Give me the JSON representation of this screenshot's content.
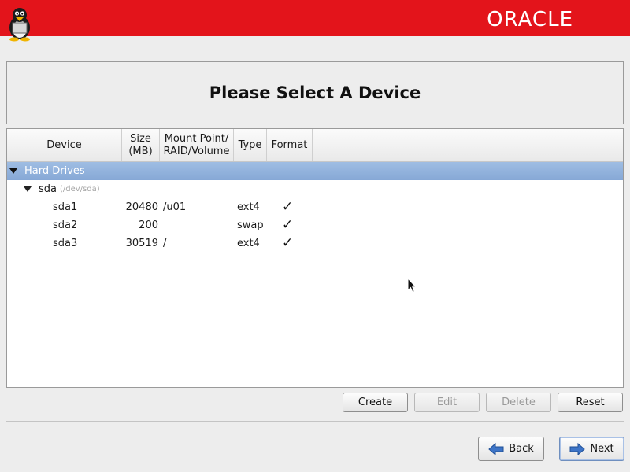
{
  "header": {
    "brand": "ORACLE",
    "brand_color": "#e3141b",
    "mascot_icon": "tux-penguin-icon"
  },
  "page": {
    "title": "Please Select A Device"
  },
  "table": {
    "columns": [
      "Device",
      "Size\n(MB)",
      "Mount Point/\nRAID/Volume",
      "Type",
      "Format"
    ],
    "group": {
      "label": "Hard Drives",
      "expanded": true
    },
    "disk": {
      "name": "sda",
      "path": "(/dev/sda)",
      "expanded": true
    },
    "partitions": [
      {
        "device": "sda1",
        "size": "20480",
        "mount": "/u01",
        "type": "ext4",
        "format": "✓"
      },
      {
        "device": "sda2",
        "size": "200",
        "mount": "",
        "type": "swap",
        "format": "✓"
      },
      {
        "device": "sda3",
        "size": "30519",
        "mount": "/",
        "type": "ext4",
        "format": "✓"
      }
    ]
  },
  "actions": {
    "create": "Create",
    "edit": "Edit",
    "delete": "Delete",
    "reset": "Reset"
  },
  "nav": {
    "back": "Back",
    "next": "Next"
  }
}
